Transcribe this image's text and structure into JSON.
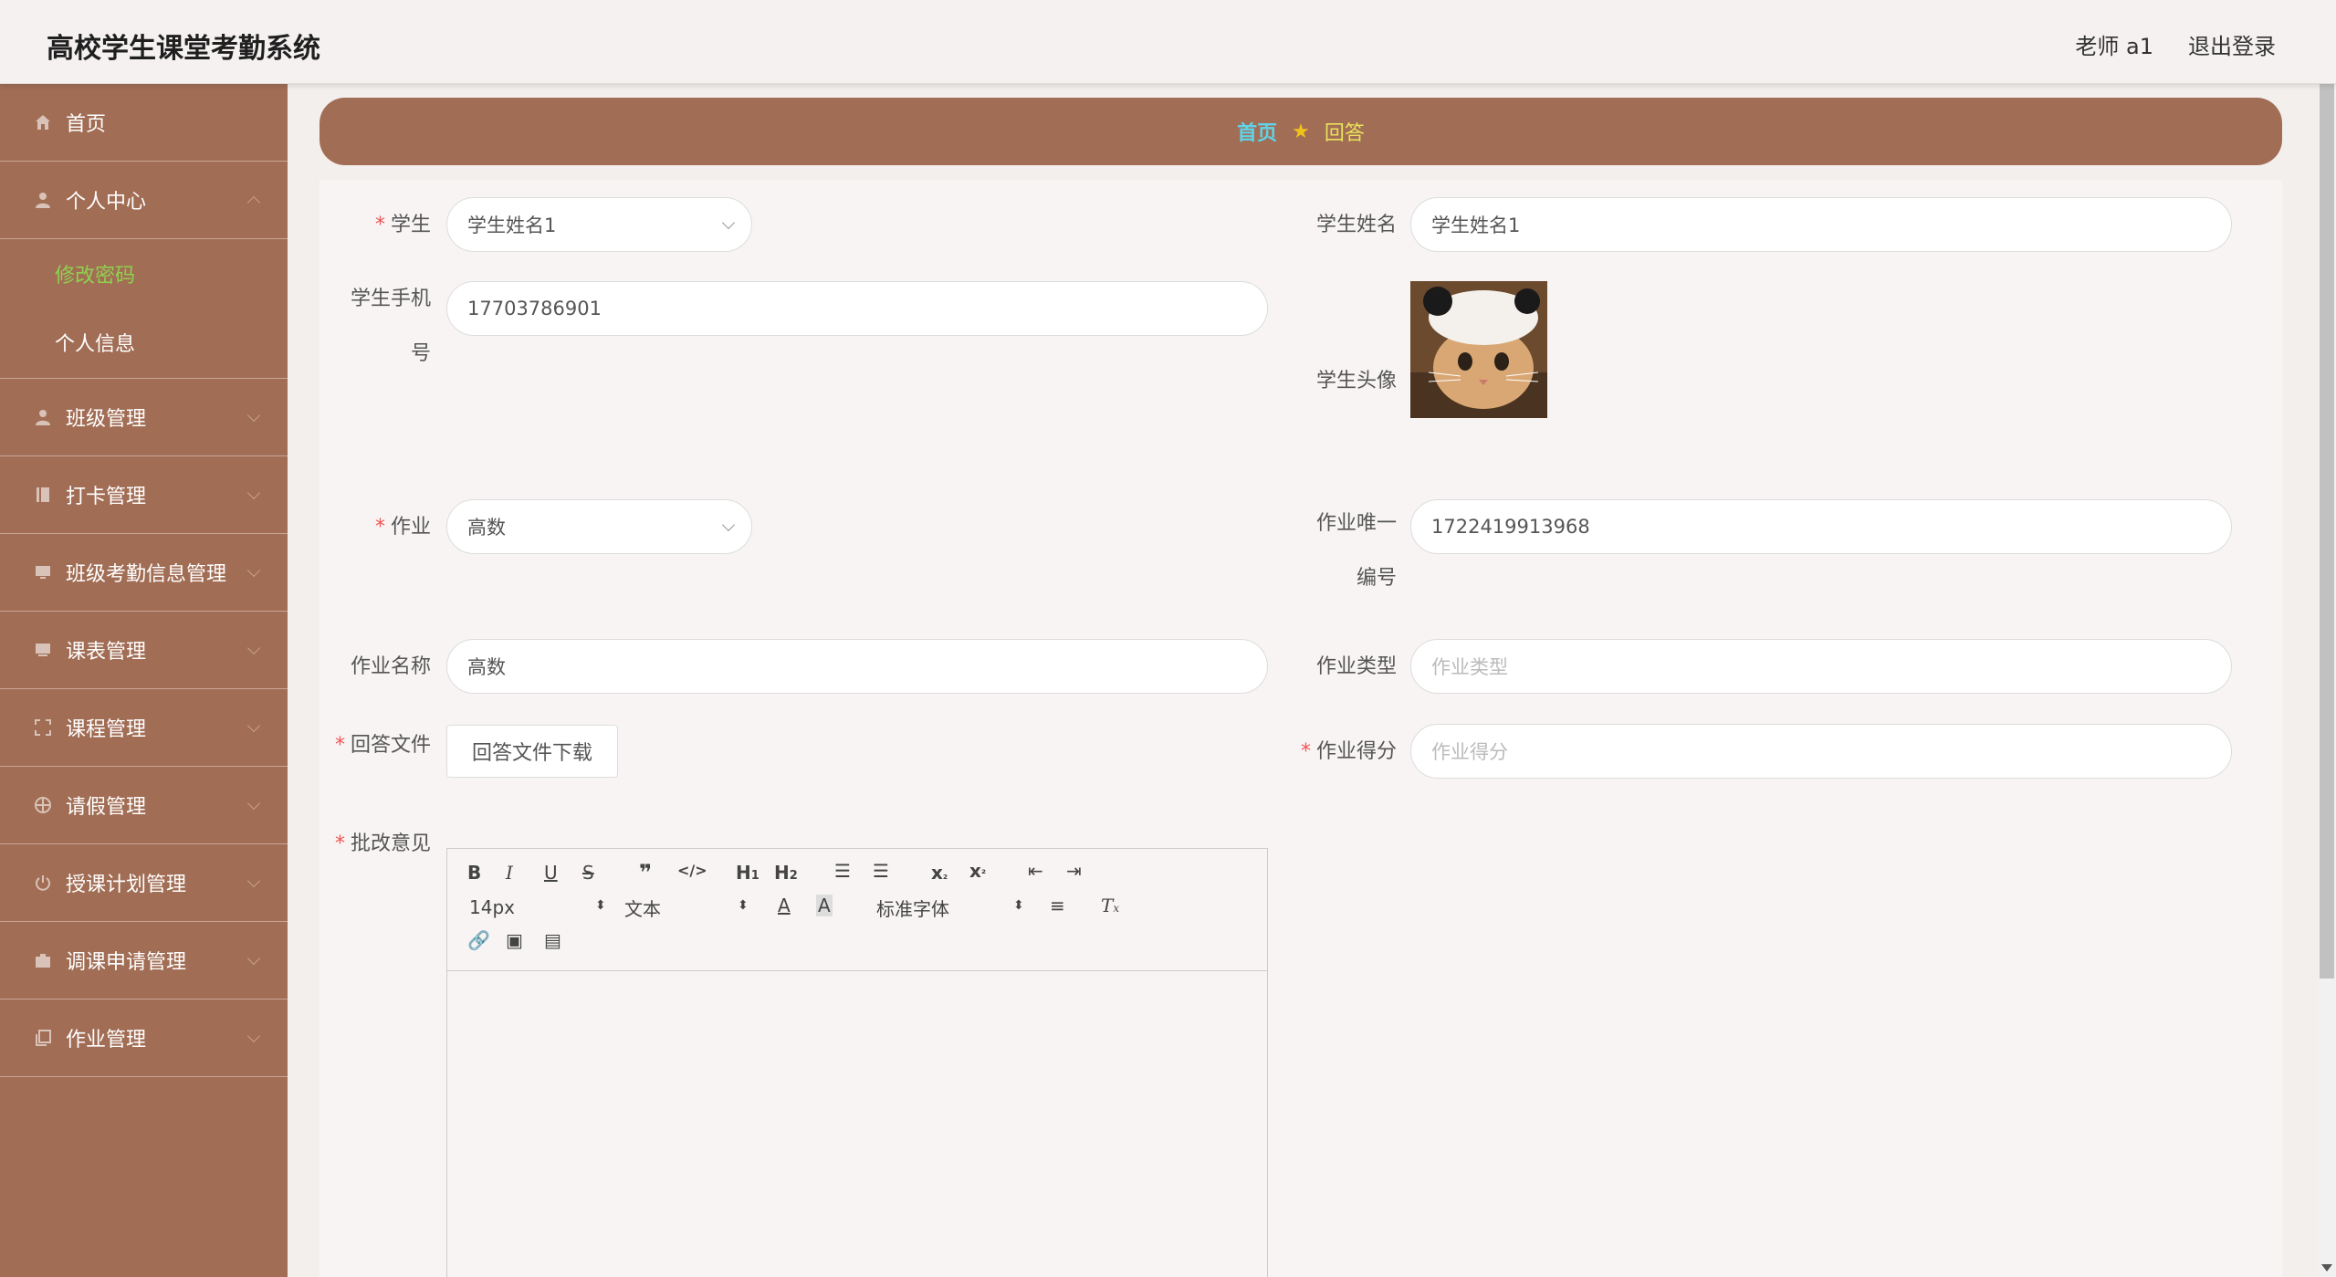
{
  "header": {
    "title": "高校学生课堂考勤系统",
    "user": "老师 a1",
    "logout": "退出登录"
  },
  "sidebar": {
    "items": [
      {
        "label": "首页",
        "icon": "home-icon"
      },
      {
        "label": "个人中心",
        "icon": "user-icon",
        "expanded": true,
        "children": [
          {
            "label": "修改密码",
            "active": true
          },
          {
            "label": "个人信息"
          }
        ]
      },
      {
        "label": "班级管理",
        "icon": "user-icon"
      },
      {
        "label": "打卡管理",
        "icon": "book-icon"
      },
      {
        "label": "班级考勤信息管理",
        "icon": "monitor-icon"
      },
      {
        "label": "课表管理",
        "icon": "monitor-icon"
      },
      {
        "label": "课程管理",
        "icon": "fullscreen-icon"
      },
      {
        "label": "请假管理",
        "icon": "compass-icon"
      },
      {
        "label": "授课计划管理",
        "icon": "power-icon"
      },
      {
        "label": "调课申请管理",
        "icon": "briefcase-icon"
      },
      {
        "label": "作业管理",
        "icon": "copy-icon"
      }
    ]
  },
  "breadcrumb": {
    "home": "首页",
    "current": "回答"
  },
  "form": {
    "student_label": "学生",
    "student_value": "学生姓名1",
    "student_name_label": "学生姓名",
    "student_name_value": "学生姓名1",
    "phone_label": "学生手机号",
    "phone_value": "17703786901",
    "avatar_label": "学生头像",
    "homework_label": "作业",
    "homework_value": "高数",
    "homework_id_label": "作业唯一编号",
    "homework_id_value": "1722419913968",
    "homework_name_label": "作业名称",
    "homework_name_value": "高数",
    "homework_type_label": "作业类型",
    "homework_type_placeholder": "作业类型",
    "answer_file_label": "回答文件",
    "answer_file_button": "回答文件下载",
    "score_label": "作业得分",
    "score_placeholder": "作业得分",
    "review_label": "批改意见"
  },
  "editor": {
    "font_size": "14px",
    "block_type": "文本",
    "font_family": "标准字体"
  },
  "colors": {
    "sidebar": "#a16d55",
    "active_menu": "#8fd14f",
    "breadcrumb_home": "#5fd3e8",
    "breadcrumb_current": "#e8e25b"
  }
}
